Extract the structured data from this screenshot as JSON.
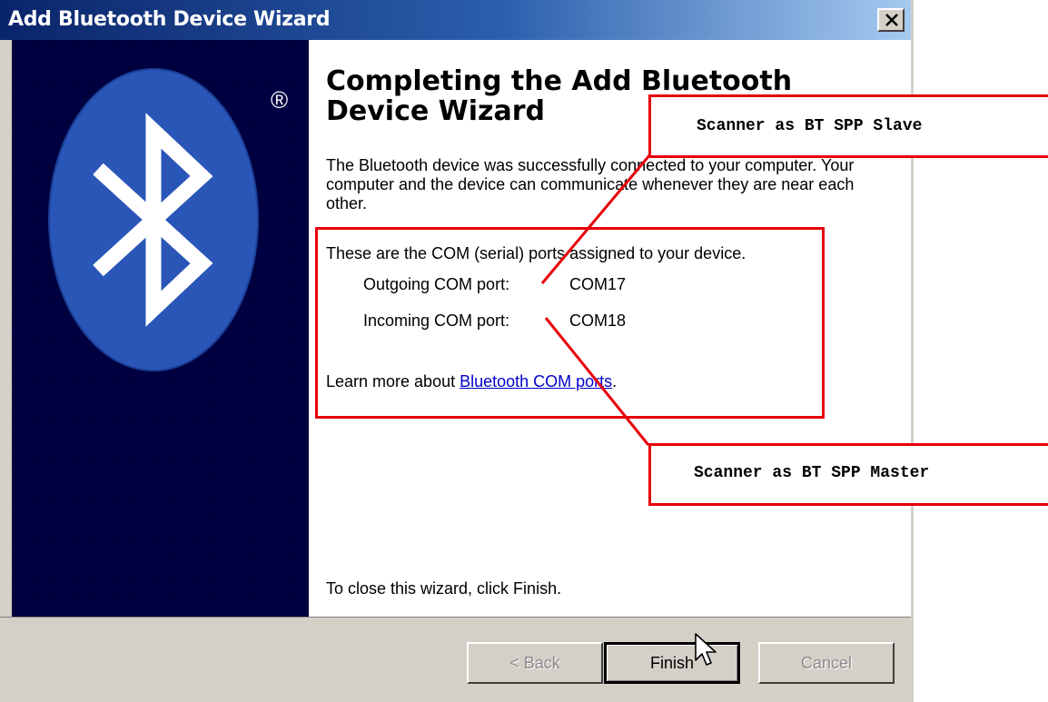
{
  "window": {
    "title": "Add Bluetooth Device Wizard",
    "close_glyph": "×"
  },
  "sidebar": {
    "logo_icon": "bluetooth-logo-icon",
    "registered_mark": "®",
    "background": "#00005f"
  },
  "content": {
    "heading": "Completing the Add Bluetooth Device Wizard",
    "paragraph": "The Bluetooth device was successfully connected to your computer. Your computer and the device can communicate whenever they are near each other.",
    "ports_intro": "These are the COM (serial) ports assigned to your device.",
    "outgoing_label": "Outgoing COM port:",
    "outgoing_value": "COM17",
    "incoming_label": "Incoming COM port:",
    "incoming_value": "COM18",
    "learn_prefix": "Learn more about ",
    "learn_link": "Bluetooth COM ports",
    "learn_suffix": ".",
    "close_hint": "To close this wizard, click Finish."
  },
  "buttons": {
    "back": "< Back",
    "finish": "Finish",
    "cancel": "Cancel"
  },
  "annotations": {
    "slave_label": "Scanner as BT SPP Slave",
    "master_label": "Scanner as BT SPP Master",
    "color": "#e8000a"
  }
}
